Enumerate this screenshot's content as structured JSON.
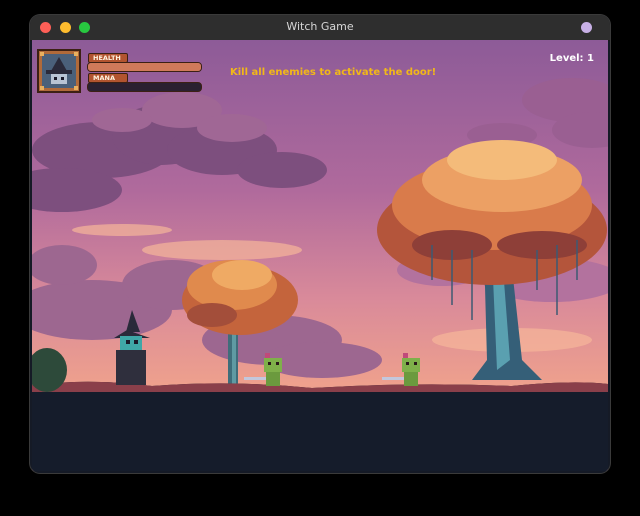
{
  "window": {
    "title": "Witch Game"
  },
  "hud": {
    "health_label": "HEALTH",
    "mana_label": "MANA",
    "health_fraction": 1.0,
    "mana_fraction": 0.0,
    "objective": "Kill all enemies to activate the door!",
    "level": "Level: 1"
  },
  "colors": {
    "objective_text": "#f2b818",
    "health_fill": "#d07a5a",
    "mana_fill": "#2a2030",
    "sky_top": "#9a5f9f",
    "sky_bottom": "#f0a890",
    "ground": "#141c2a"
  }
}
